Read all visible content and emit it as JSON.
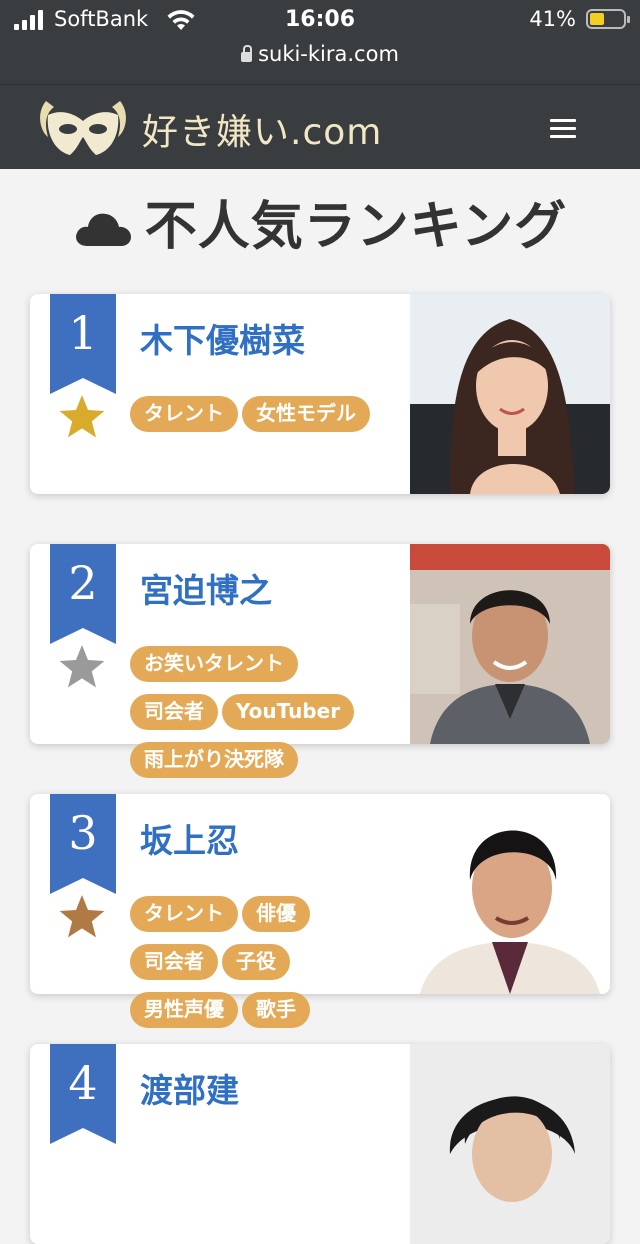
{
  "status_bar": {
    "carrier": "SoftBank",
    "time": "16:06",
    "battery": "41%",
    "url": "suki-kira.com"
  },
  "site": {
    "logo_text": "好き嫌い.com",
    "menu_icon": "hamburger-menu-icon"
  },
  "page": {
    "title": "不人気ランキング",
    "title_icon": "cloud-icon"
  },
  "ranking": [
    {
      "rank": "1",
      "name": "木下優樹菜",
      "star_color": "#d8ac2a",
      "tags": [
        "タレント",
        "女性モデル"
      ]
    },
    {
      "rank": "2",
      "name": "宮迫博之",
      "star_color": "#9a9a9a",
      "tags": [
        "お笑いタレント",
        "司会者",
        "YouTuber",
        "雨上がり決死隊"
      ]
    },
    {
      "rank": "3",
      "name": "坂上忍",
      "star_color": "#b07a45",
      "tags": [
        "タレント",
        "俳優",
        "司会者",
        "子役",
        "男性声優",
        "歌手"
      ]
    },
    {
      "rank": "4",
      "name": "渡部建",
      "star_color": "#9a9a9a",
      "tags": []
    }
  ],
  "colors": {
    "header_bg": "#3a3d40",
    "ribbon": "#3f6fbf",
    "name": "#2f6fc4",
    "tag": "#e4a956"
  }
}
